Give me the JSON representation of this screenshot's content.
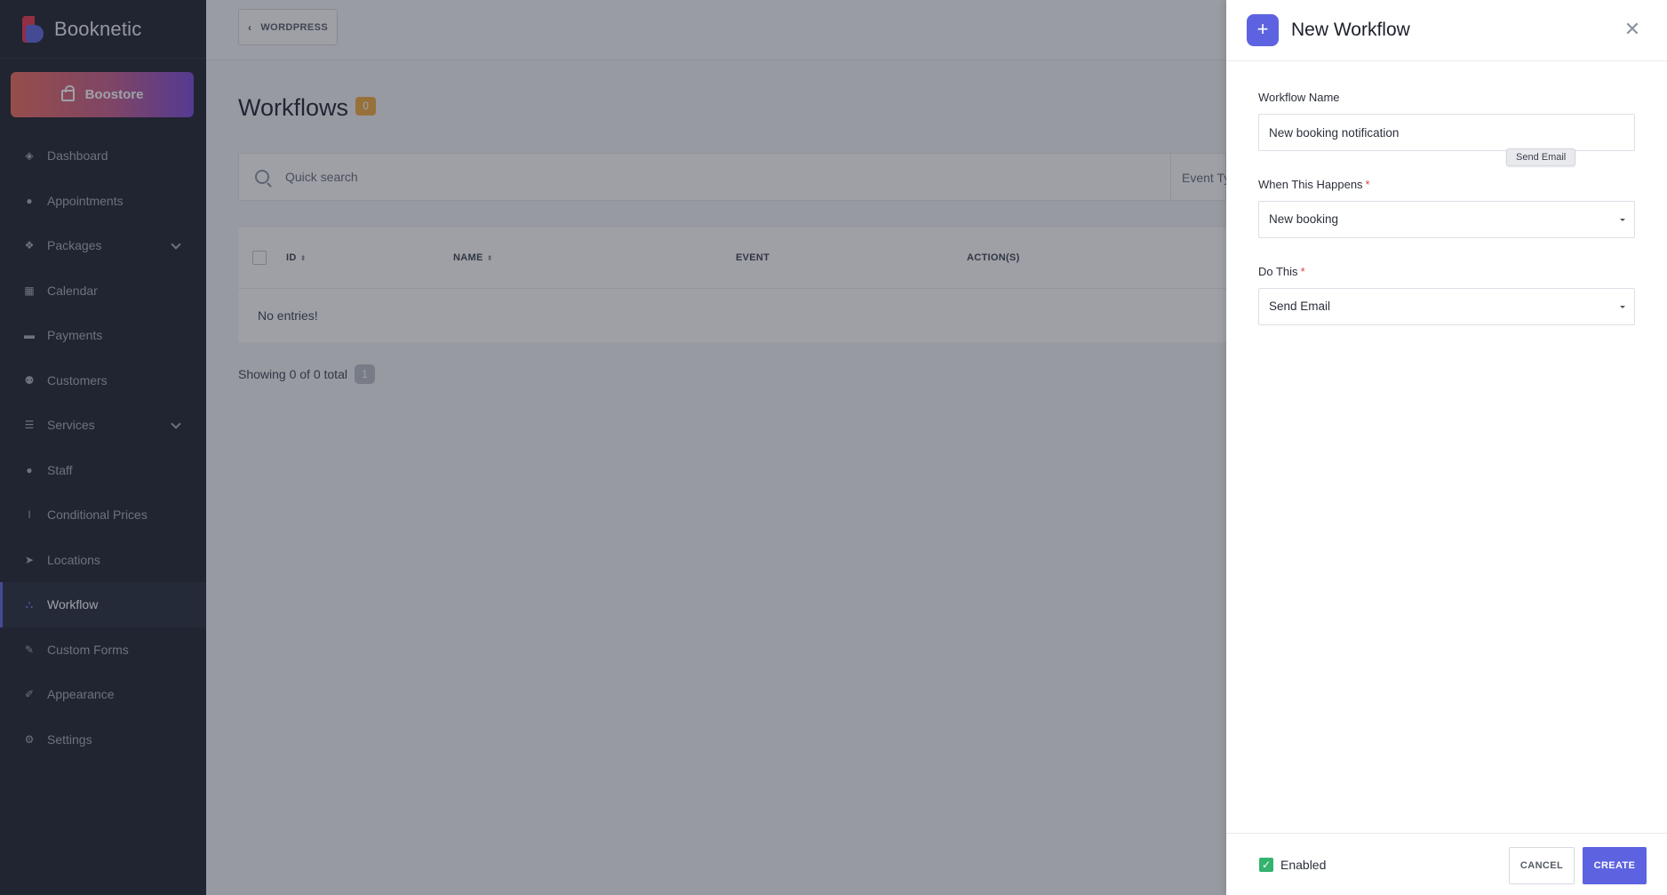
{
  "brand": {
    "name": "Booknetic"
  },
  "boostore": {
    "label": "Boostore"
  },
  "sidebar": {
    "items": [
      {
        "label": "Dashboard",
        "icon": "dashboard-icon"
      },
      {
        "label": "Appointments",
        "icon": "clock-icon"
      },
      {
        "label": "Packages",
        "icon": "packages-icon"
      },
      {
        "label": "Calendar",
        "icon": "calendar-icon"
      },
      {
        "label": "Payments",
        "icon": "credit-card-icon"
      },
      {
        "label": "Customers",
        "icon": "users-icon"
      },
      {
        "label": "Services",
        "icon": "list-icon"
      },
      {
        "label": "Staff",
        "icon": "user-icon"
      },
      {
        "label": "Conditional Prices",
        "icon": "text-cursor-icon"
      },
      {
        "label": "Locations",
        "icon": "location-arrow-icon"
      },
      {
        "label": "Workflow",
        "icon": "workflow-icon"
      },
      {
        "label": "Custom Forms",
        "icon": "magic-wand-icon"
      },
      {
        "label": "Appearance",
        "icon": "brush-icon"
      },
      {
        "label": "Settings",
        "icon": "gear-icon"
      }
    ],
    "active": "Workflow"
  },
  "topbar": {
    "back_label": "WORDPRESS"
  },
  "page": {
    "title": "Workflows",
    "count": "0",
    "search_placeholder": "Quick search",
    "event_filter": "Event Type"
  },
  "table": {
    "columns": [
      "ID",
      "NAME",
      "EVENT",
      "ACTION(S)"
    ],
    "empty_text": "No entries!",
    "showing": "Showing 0 of 0 total",
    "page_number": "1"
  },
  "drawer": {
    "title": "New Workflow",
    "workflow_name_label": "Workflow Name",
    "workflow_name_value": "New booking notification",
    "tooltip": "Send Email",
    "when_label": "When This Happens",
    "when_value": "New booking",
    "do_label": "Do This",
    "do_value": "Send Email",
    "enabled_label": "Enabled",
    "cancel_label": "CANCEL",
    "create_label": "CREATE"
  },
  "colors": {
    "accent": "#5d63e0",
    "brand_red": "#e9324f",
    "badge": "#f2a93b",
    "enabled": "#34b36f"
  }
}
